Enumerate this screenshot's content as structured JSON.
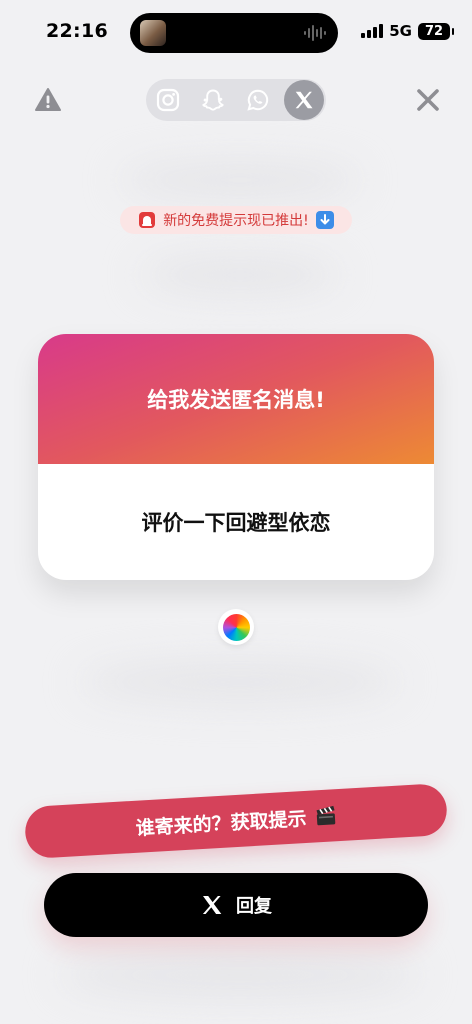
{
  "status_bar": {
    "time": "22:16",
    "network": "5G",
    "battery": "72"
  },
  "top_bar": {
    "warning_icon": "warning-triangle-icon",
    "close_icon": "close-x-icon",
    "share_targets": [
      "instagram-icon",
      "snapchat-icon",
      "whatsapp-icon",
      "x-icon"
    ],
    "active_share_target": "x"
  },
  "banner": {
    "text": "新的免费提示现已推出!",
    "left_icon": "siren-icon",
    "right_icon": "down-arrow-icon"
  },
  "card": {
    "title": "给我发送匿名消息!",
    "question": "评价一下回避型依恋",
    "gradient": [
      "#d83a8a",
      "#e2585e",
      "#ed8a34"
    ]
  },
  "dice_icon": "rainbow-dice-icon",
  "hint_button": {
    "label": "谁寄来的？获取提示",
    "icon": "clapperboard-icon",
    "color": "#d5425a"
  },
  "reply_button": {
    "label": "回复",
    "icon": "x-logo-icon",
    "color": "#000000"
  }
}
